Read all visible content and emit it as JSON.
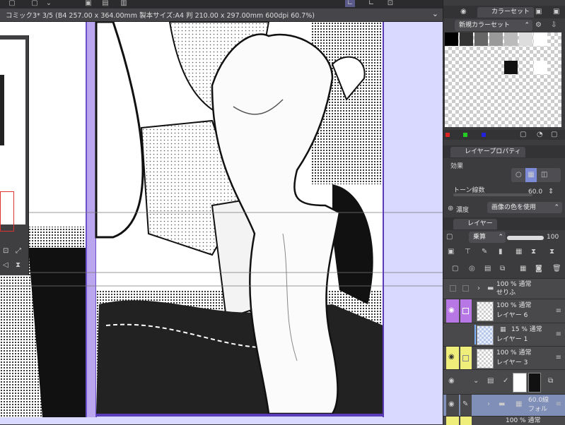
{
  "document_tab": {
    "title": "コミック3* 3/5 (B4 257.00 x 364.00mm 製本サイズ:A4 判 210.00 x 297.00mm 600dpi 60.7%)"
  },
  "color_set_panel": {
    "tab_label": "カラーセット",
    "set_name": "新規カラーセット",
    "palette": [
      "#000000",
      "#333333",
      "#666666",
      "#999999",
      "#bbbbbb",
      "#dddddd",
      "#ffffff"
    ],
    "extra": [
      "#000000",
      "#ffffff"
    ]
  },
  "layer_property_panel": {
    "tab_label": "レイヤープロパティ",
    "effect_label": "効果",
    "tone_lines_label": "トーン線数",
    "tone_lines_value": "60.0",
    "density_label": "濃度",
    "density_value": "画像の色を使用"
  },
  "layer_panel": {
    "tab_label": "レイヤー",
    "blend_mode": "乗算",
    "opacity": "100",
    "layers": [
      {
        "line1": "100 % 通常",
        "line2": "せりふ",
        "type": "folder",
        "visible": false,
        "color": "none"
      },
      {
        "line1": "100 % 通常",
        "line2": "レイヤー 6",
        "type": "raster",
        "visible": true,
        "color": "#b778e6"
      },
      {
        "line1": "15 % 通常",
        "line2": "レイヤー 1",
        "type": "raster",
        "visible": false,
        "color": "none"
      },
      {
        "line1": "100 % 通常",
        "line2": "レイヤー 3",
        "type": "raster",
        "visible": true,
        "color": "#f0ee7a"
      },
      {
        "line1": "",
        "line2": "",
        "type": "mask",
        "visible": true,
        "color": "none"
      },
      {
        "line1": "60.0線",
        "line2": "フォル",
        "type": "tone-folder",
        "visible": true,
        "color": "none"
      },
      {
        "line1": "100 % 通常",
        "line2": "",
        "type": "raster",
        "visible": true,
        "color": "#f0ee7a"
      }
    ]
  }
}
